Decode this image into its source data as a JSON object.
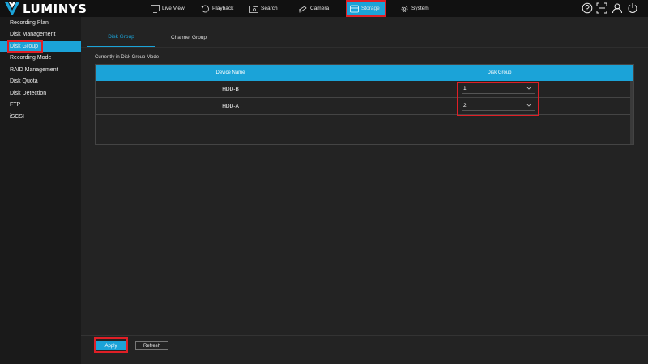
{
  "brand": {
    "name": "LUMINYS"
  },
  "nav": {
    "items": [
      {
        "label": "Live View",
        "icon": "monitor-icon"
      },
      {
        "label": "Playback",
        "icon": "playback-icon"
      },
      {
        "label": "Search",
        "icon": "folder-search-icon"
      },
      {
        "label": "Camera",
        "icon": "camera-icon"
      },
      {
        "label": "Storage",
        "icon": "storage-icon",
        "active": true
      },
      {
        "label": "System",
        "icon": "gear-icon"
      }
    ],
    "tools": [
      "help-icon",
      "fullscreen-icon",
      "user-icon",
      "power-icon"
    ]
  },
  "sidebar": {
    "items": [
      {
        "label": "Recording Plan"
      },
      {
        "label": "Disk Management"
      },
      {
        "label": "Disk Group",
        "active": true
      },
      {
        "label": "Recording Mode"
      },
      {
        "label": "RAID Management"
      },
      {
        "label": "Disk Quota"
      },
      {
        "label": "Disk Detection"
      },
      {
        "label": "FTP"
      },
      {
        "label": "iSCSI"
      }
    ]
  },
  "tabs": [
    {
      "label": "Disk Group",
      "active": true
    },
    {
      "label": "Channel Group",
      "active": false
    }
  ],
  "section": {
    "title": "Currently in Disk Group Mode"
  },
  "table": {
    "headers": [
      "Device Name",
      "Disk Group"
    ],
    "rows": [
      {
        "device": "HDD-B",
        "group": "1"
      },
      {
        "device": "HDD-A",
        "group": "2"
      }
    ]
  },
  "buttons": {
    "apply": "Apply",
    "refresh": "Refresh"
  },
  "colors": {
    "accent": "#1ba3d8",
    "highlight": "#e01f26",
    "topbar": "#111111",
    "sidebar": "#1a1a1a",
    "background": "#232323"
  }
}
